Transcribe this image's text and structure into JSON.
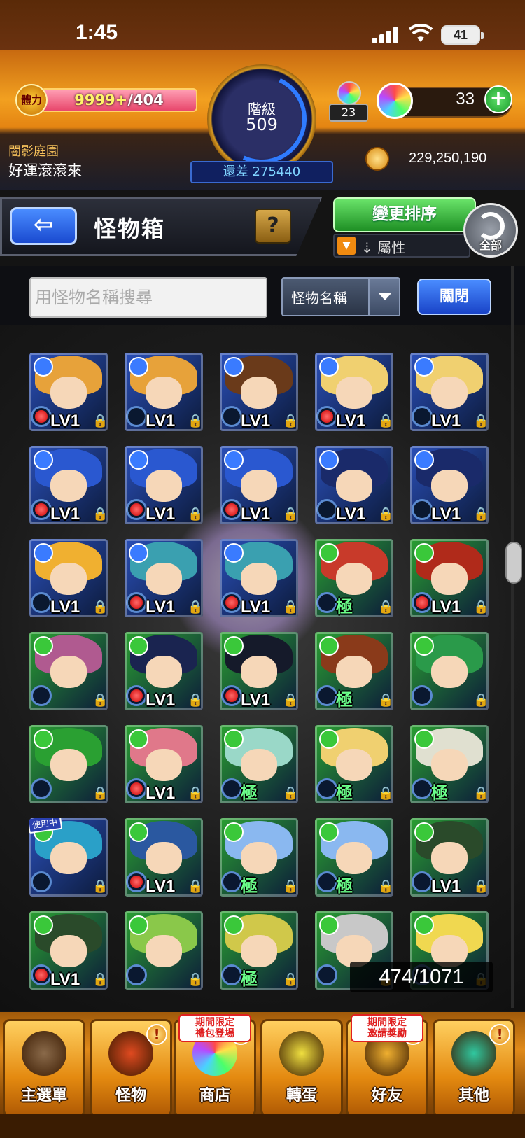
{
  "status_bar": {
    "time": "1:45",
    "battery": "41"
  },
  "header": {
    "stamina_icon": "體力",
    "stamina_current": "9999+",
    "stamina_max": "/404",
    "stamina_fraction": 1.0,
    "rank_label": "階級",
    "rank_value": "509",
    "exp_diff": "還差 275440",
    "orb_small_count": "23",
    "orb_total": "33",
    "stage_name": "闇影庭園",
    "player_name": "好運滾滾來",
    "coins": "229,250,190"
  },
  "toolbar": {
    "back_icon": "back-arrow-icon",
    "title": "怪物箱",
    "help": "?",
    "sort": "變更排序",
    "filter": "屬性",
    "all": "全部"
  },
  "search": {
    "placeholder": "用怪物名稱搜尋",
    "select_value": "怪物名稱",
    "close": "關閉"
  },
  "monsters": [
    {
      "lv": "LV1",
      "hair": "#e7a23a",
      "bg": "#2a4fb8",
      "el": "#3a7bff",
      "fruit": true
    },
    {
      "lv": "LV1",
      "hair": "#e7a23a",
      "bg": "#2a4fb8",
      "el": "#3a7bff",
      "fruit": false
    },
    {
      "lv": "LV1",
      "hair": "#6a3a1a",
      "bg": "#2a4fb8",
      "el": "#3a7bff",
      "fruit": false
    },
    {
      "lv": "LV1",
      "hair": "#f0d070",
      "bg": "#2a4fb8",
      "el": "#3a7bff",
      "fruit": true
    },
    {
      "lv": "LV1",
      "hair": "#f0d070",
      "bg": "#2a4fb8",
      "el": "#3a7bff",
      "fruit": false
    },
    {
      "lv": "LV1",
      "hair": "#2a58d0",
      "bg": "#2a4fb8",
      "el": "#3a7bff",
      "fruit": true
    },
    {
      "lv": "LV1",
      "hair": "#2a58d0",
      "bg": "#2a4fb8",
      "el": "#3a7bff",
      "fruit": true
    },
    {
      "lv": "LV1",
      "hair": "#2a58d0",
      "bg": "#2a4fb8",
      "el": "#3a7bff",
      "fruit": true
    },
    {
      "lv": "LV1",
      "hair": "#1a2a6a",
      "bg": "#2a4fb8",
      "el": "#3a7bff",
      "fruit": false
    },
    {
      "lv": "LV1",
      "hair": "#1a2a6a",
      "bg": "#2a4fb8",
      "el": "#3a7bff",
      "fruit": false
    },
    {
      "lv": "LV1",
      "hair": "#f0b030",
      "bg": "#2a4fb8",
      "el": "#3a7bff",
      "fruit": false
    },
    {
      "lv": "LV1",
      "hair": "#3aa0b0",
      "bg": "#2a4fb8",
      "el": "#3a7bff",
      "fruit": true
    },
    {
      "lv": "LV1",
      "hair": "#3aa0b0",
      "bg": "#2a4fb8",
      "el": "#3a7bff",
      "fruit": true
    },
    {
      "lv": "極",
      "hair": "#c83a2a",
      "bg": "#2aa032",
      "el": "#3ac83a",
      "fruit": false
    },
    {
      "lv": "LV1",
      "hair": "#b02a1a",
      "bg": "#2aa032",
      "el": "#3ac83a",
      "fruit": true
    },
    {
      "lv": "",
      "hair": "#b05a90",
      "bg": "#2aa032",
      "el": "#3ac83a",
      "fruit": false
    },
    {
      "lv": "LV1",
      "hair": "#1a2450",
      "bg": "#2aa032",
      "el": "#3ac83a",
      "fruit": true
    },
    {
      "lv": "LV1",
      "hair": "#151a2a",
      "bg": "#2aa032",
      "el": "#3ac83a",
      "fruit": true
    },
    {
      "lv": "極",
      "hair": "#8a3a1a",
      "bg": "#2aa032",
      "el": "#3ac83a",
      "fruit": false
    },
    {
      "lv": "",
      "hair": "#2a9a4a",
      "bg": "#2aa032",
      "el": "#3ac83a",
      "fruit": false
    },
    {
      "lv": "",
      "hair": "#2aa032",
      "bg": "#2aa032",
      "el": "#3ac83a",
      "fruit": false
    },
    {
      "lv": "LV1",
      "hair": "#e0788a",
      "bg": "#2aa032",
      "el": "#3ac83a",
      "fruit": true
    },
    {
      "lv": "極",
      "hair": "#9ad8c8",
      "bg": "#2aa032",
      "el": "#3ac83a",
      "fruit": false
    },
    {
      "lv": "極",
      "hair": "#f0d070",
      "bg": "#2aa032",
      "el": "#3ac83a",
      "fruit": false
    },
    {
      "lv": "極",
      "hair": "#e0e0d0",
      "bg": "#2aa032",
      "el": "#3ac83a",
      "fruit": false
    },
    {
      "lv": "",
      "hair": "#2aa0c8",
      "bg": "#2a4fb8",
      "el": "#3ac83a",
      "fruit": false,
      "in_use": true
    },
    {
      "lv": "LV1",
      "hair": "#2a58a0",
      "bg": "#2aa032",
      "el": "#3ac83a",
      "fruit": true
    },
    {
      "lv": "極",
      "hair": "#8ab8f0",
      "bg": "#2aa032",
      "el": "#3ac83a",
      "fruit": false
    },
    {
      "lv": "極",
      "hair": "#8ab8f0",
      "bg": "#2aa032",
      "el": "#3ac83a",
      "fruit": false
    },
    {
      "lv": "LV1",
      "hair": "#2a4a2a",
      "bg": "#2aa032",
      "el": "#3ac83a",
      "fruit": false
    },
    {
      "lv": "LV1",
      "hair": "#2a4a2a",
      "bg": "#2aa032",
      "el": "#3ac83a",
      "fruit": true
    },
    {
      "lv": "",
      "hair": "#8ac84a",
      "bg": "#2aa032",
      "el": "#3ac83a",
      "fruit": false
    },
    {
      "lv": "極",
      "hair": "#d0c84a",
      "bg": "#2aa032",
      "el": "#3ac83a",
      "fruit": false
    },
    {
      "lv": "",
      "hair": "#c8c8c8",
      "bg": "#2aa032",
      "el": "#3ac83a",
      "fruit": false
    },
    {
      "lv": "",
      "hair": "#f0d850",
      "bg": "#2aa032",
      "el": "#3ac83a",
      "fruit": false
    }
  ],
  "in_use_label": "使用中",
  "box_count": "474/1071",
  "nav": [
    {
      "label": "主選單",
      "icon": "gate-icon",
      "color": "#8a6a4a",
      "tag": "",
      "alert": false
    },
    {
      "label": "怪物",
      "icon": "monster-icon",
      "color": "#e04a20",
      "tag": "",
      "alert": true
    },
    {
      "label": "商店",
      "icon": "orb-shop-icon",
      "color": "#ffffff",
      "tag": "期間限定\n禮包登場",
      "alert": true
    },
    {
      "label": "轉蛋",
      "icon": "egg-icon",
      "color": "#f0e040",
      "tag": "",
      "alert": false
    },
    {
      "label": "好友",
      "icon": "friend-icon",
      "color": "#f0b030",
      "tag": "期間限定\n邀請獎勵",
      "alert": true
    },
    {
      "label": "其他",
      "icon": "diamond-icon",
      "color": "#30c8a0",
      "tag": "",
      "alert": true
    }
  ]
}
